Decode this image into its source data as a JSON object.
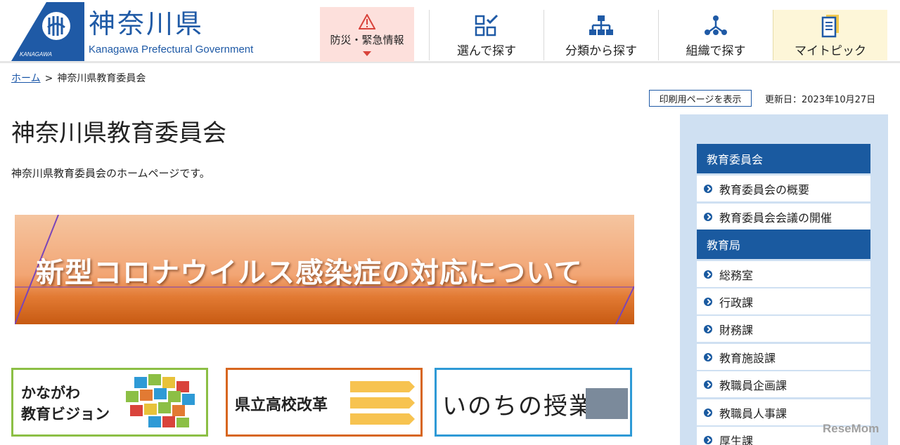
{
  "header": {
    "logo_ja": "神奈川県",
    "logo_en": "Kanagawa Prefectural Government",
    "logo_mark_text": "KANAGAWA",
    "disaster_label": "防災・緊急情報",
    "nav": [
      {
        "label": "選んで探す",
        "icon": "checklist-icon"
      },
      {
        "label": "分類から探す",
        "icon": "hierarchy-icon"
      },
      {
        "label": "組織で探す",
        "icon": "organization-icon"
      },
      {
        "label": "マイトピック",
        "icon": "document-icon"
      }
    ]
  },
  "breadcrumb": {
    "home": "ホーム",
    "separator": ">",
    "current": "神奈川県教育委員会"
  },
  "print_label": "印刷用ページを表示",
  "updated": "更新日：2023年10月27日",
  "page_title": "神奈川県教育委員会",
  "intro": "神奈川県教育委員会のホームページです。",
  "banner": {
    "text": "新型コロナウイルス感染症の対応について"
  },
  "cards": [
    {
      "line1": "かながわ",
      "line2": "教育ビジョン"
    },
    {
      "text": "県立高校改革"
    },
    {
      "text": "いのちの授業"
    }
  ],
  "sidebar": {
    "sections": [
      {
        "title": "教育委員会",
        "items": [
          "教育委員会の概要",
          "教育委員会会議の開催"
        ]
      },
      {
        "title": "教育局",
        "items": [
          "総務室",
          "行政課",
          "財務課",
          "教育施設課",
          "教職員企画課",
          "教職員人事課",
          "厚生課"
        ]
      }
    ]
  },
  "colors": {
    "brand_blue": "#1f5aa6",
    "sidebar_head": "#1a5aa0",
    "sidebar_bg": "#cfe0f2",
    "disaster_bg": "#fde0dc",
    "mytopic_bg": "#fdf6d8"
  },
  "watermark": "ReseMom"
}
